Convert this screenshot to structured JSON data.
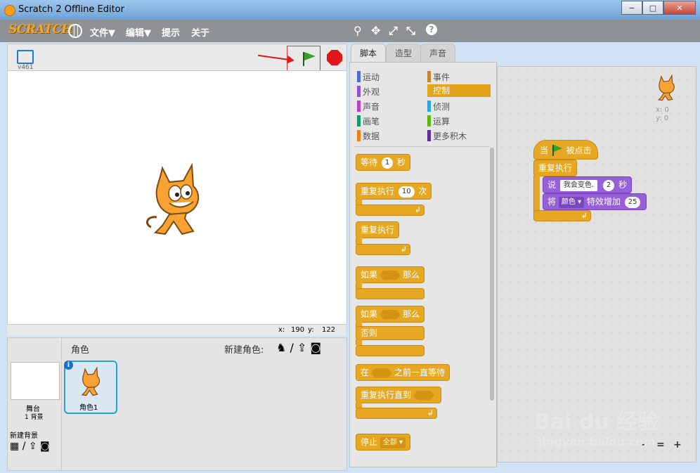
{
  "window": {
    "title": "Scratch 2 Offline Editor",
    "min": "−",
    "max": "□",
    "close": "✕"
  },
  "menubar": {
    "logo": "SCRATCH",
    "file": "文件▼",
    "edit": "编辑▼",
    "tips": "提示",
    "about": "关于",
    "tool_stamp": "⚲",
    "tool_move": "✥",
    "tool_grow": "⤢",
    "tool_shrink": "⤡",
    "tool_help": "?"
  },
  "stage": {
    "version": "v461",
    "x_label": "x:",
    "x_value": "190",
    "y_label": "y:",
    "y_value": "122"
  },
  "sprites": {
    "title": "角色",
    "new_sprite": "新建角色:",
    "stage_label": "舞台",
    "stage_bg": "1 背景",
    "new_backdrop": "新建背景",
    "sprite1": "角色1",
    "info": "i"
  },
  "tabs": [
    "脚本",
    "造型",
    "声音"
  ],
  "categories": [
    {
      "label": "运动",
      "color": "#4a6cd4"
    },
    {
      "label": "外观",
      "color": "#8a55d7"
    },
    {
      "label": "声音",
      "color": "#bb42c3"
    },
    {
      "label": "画笔",
      "color": "#0e9a6c"
    },
    {
      "label": "数据",
      "color": "#ee7d16"
    },
    {
      "label": "事件",
      "color": "#c88330"
    },
    {
      "label": "控制",
      "color": "#e1a91a"
    },
    {
      "label": "侦测",
      "color": "#2ca5e2"
    },
    {
      "label": "运算",
      "color": "#5cb712"
    },
    {
      "label": "更多积木",
      "color": "#632d99"
    }
  ],
  "palette_blocks": {
    "wait": "等待",
    "wait_val": "1",
    "wait_unit": "秒",
    "repeat": "重复执行",
    "repeat_val": "10",
    "repeat_unit": "次",
    "forever": "重复执行",
    "if": "如果",
    "then": "那么",
    "if2": "如果",
    "then2": "那么",
    "else": "否则",
    "waituntil_pre": "在",
    "waituntil_post": "之前一直等待",
    "repeatuntil": "重复执行直到",
    "stop": "停止",
    "stop_opt": "全部 ▾"
  },
  "script": {
    "hat_pre": "当",
    "hat_post": "被点击",
    "forever": "重复执行",
    "say": "说",
    "say_text": "我会变色.",
    "say_secs": "2",
    "say_unit": "秒",
    "effect_pre": "将",
    "effect_opt": "颜色 ▾",
    "effect_mid": "特效增加",
    "effect_val": "25",
    "sprite_x": "x: 0",
    "sprite_y": "y: 0"
  },
  "zoom": {
    "out": "−",
    "reset": "=",
    "in": "+"
  },
  "watermark": {
    "brand": "Bai du 经验",
    "url": "jingyan.baidu.com"
  }
}
